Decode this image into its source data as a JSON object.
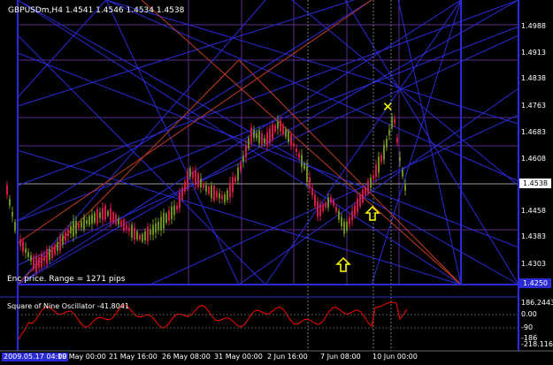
{
  "header": {
    "symbol_label": "GBPUSDm,H4",
    "ohlc": "1.4541 1.4546 1.4534 1.4538"
  },
  "annotation": {
    "range_text": "Enc price. Range = 1271 pips"
  },
  "price_axis": {
    "ticks": [
      "1.4988",
      "1.4913",
      "1.4838",
      "1.4763",
      "1.4683",
      "1.4608",
      "1.4458",
      "1.4383",
      "1.4303"
    ],
    "current_price": "1.4538",
    "low_price": "1.4250"
  },
  "oscillator": {
    "title": "Square of Nine Oscillator -41.8041",
    "ticks": [
      "186.2443",
      "0.00",
      "-90",
      "-186",
      "-218.116"
    ]
  },
  "time_axis": {
    "first_label": "2009.05.17 04:00",
    "labels": [
      "19 May 00:00",
      "21 May 16:00",
      "26 May 08:00",
      "31 May 00:00",
      "2 Jun 16:00",
      "7 Jun 08:00",
      "10 Jun 00:00"
    ]
  },
  "markers": {
    "cross_symbol": "✕",
    "arrow_count": 2
  },
  "colors": {
    "background": "#000000",
    "bull_candle": "#6b8e23",
    "bear_candle": "#cd1c46",
    "gann_lines_blue": "#2b2bd6",
    "gann_lines_red": "#c23b22",
    "grid_purple": "#5a2a8a",
    "oscillator_line": "#ff0000",
    "marker_yellow": "#ffff00"
  }
}
